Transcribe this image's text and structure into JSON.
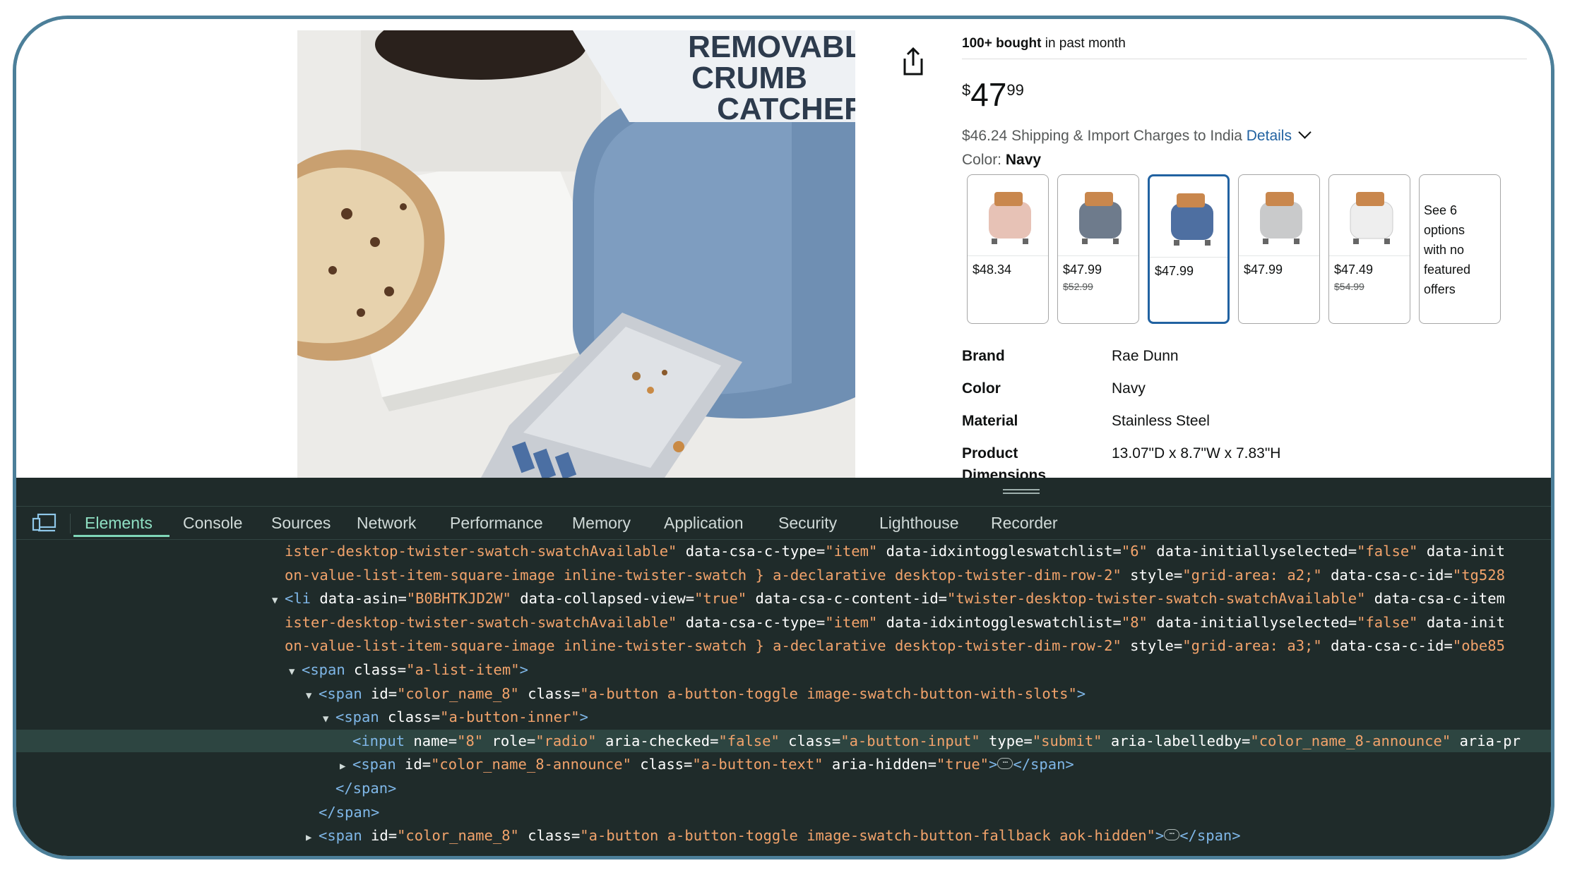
{
  "product": {
    "image_text": [
      "REMOVABLE",
      "CRUMB",
      "CATCHER"
    ],
    "bought_bold": "100+ bought",
    "bought_rest": " in past month",
    "price_symbol": "$",
    "price_whole": "47",
    "price_fraction": "99",
    "shipping_text": "$46.24 Shipping & Import Charges to India ",
    "shipping_details": "Details",
    "color_label": "Color: ",
    "color_value": "Navy",
    "swatches": [
      {
        "price": "$48.34",
        "old": "",
        "color": "#e7c2b6"
      },
      {
        "price": "$47.99",
        "old": "$52.99",
        "color": "#6e7b8c"
      },
      {
        "price": "$47.99",
        "old": "",
        "color": "#4e6fa1"
      },
      {
        "price": "$47.99",
        "old": "",
        "color": "#c9cacb"
      },
      {
        "price": "$47.49",
        "old": "$54.99",
        "color": "#eeeeee"
      }
    ],
    "more_options": [
      "See 6",
      "options",
      "with no",
      "featured",
      "offers"
    ],
    "specs": [
      {
        "key": "Brand",
        "value": "Rae Dunn"
      },
      {
        "key": "Color",
        "value": "Navy"
      },
      {
        "key": "Material",
        "value": "Stainless Steel"
      },
      {
        "key": "Product",
        "key2": "Dimensions",
        "value": "13.07\"D x 8.7\"W x 7.83\"H"
      }
    ]
  },
  "devtools": {
    "tabs": [
      "Elements",
      "Console",
      "Sources",
      "Network",
      "Performance",
      "Memory",
      "Application",
      "Security",
      "Lighthouse",
      "Recorder"
    ],
    "active_tab": "Elements",
    "colors": {
      "tag": "#7fb7e8",
      "attr": "#ffffff",
      "value": "#f2a36b",
      "active_tab": "#8fe0c3"
    },
    "lines": [
      {
        "indent": 0,
        "tri": "",
        "parts": [
          [
            "v",
            "ister-desktop-twister-swatch-swatchAvailable\""
          ],
          [
            "a",
            " data-csa-c-type="
          ],
          [
            "v",
            "\"item\""
          ],
          [
            "a",
            " data-idxintoggleswatchlist="
          ],
          [
            "v",
            "\"6\""
          ],
          [
            "a",
            " data-initiallyselected="
          ],
          [
            "v",
            "\"false\""
          ],
          [
            "a",
            " data-init"
          ]
        ]
      },
      {
        "indent": 0,
        "tri": "",
        "parts": [
          [
            "v",
            "on-value-list-item-square-image inline-twister-swatch } a-declarative desktop-twister-dim-row-2\""
          ],
          [
            "a",
            " style="
          ],
          [
            "v",
            "\"grid-area: a2;\""
          ],
          [
            "a",
            " data-csa-c-id="
          ],
          [
            "v",
            "\"tg528"
          ]
        ]
      },
      {
        "indent": 0,
        "tri": "▼",
        "parts": [
          [
            "t",
            "<li"
          ],
          [
            "a",
            " data-asin="
          ],
          [
            "v",
            "\"B0BHTKJD2W\""
          ],
          [
            "a",
            " data-collapsed-view="
          ],
          [
            "v",
            "\"true\""
          ],
          [
            "a",
            " data-csa-c-content-id="
          ],
          [
            "v",
            "\"twister-desktop-twister-swatch-swatchAvailable\""
          ],
          [
            "a",
            " data-csa-c-item"
          ]
        ]
      },
      {
        "indent": 0,
        "tri": "",
        "parts": [
          [
            "v",
            "ister-desktop-twister-swatch-swatchAvailable\""
          ],
          [
            "a",
            " data-csa-c-type="
          ],
          [
            "v",
            "\"item\""
          ],
          [
            "a",
            " data-idxintoggleswatchlist="
          ],
          [
            "v",
            "\"8\""
          ],
          [
            "a",
            " data-initiallyselected="
          ],
          [
            "v",
            "\"false\""
          ],
          [
            "a",
            " data-init"
          ]
        ]
      },
      {
        "indent": 0,
        "tri": "",
        "parts": [
          [
            "v",
            "on-value-list-item-square-image inline-twister-swatch } a-declarative desktop-twister-dim-row-2\""
          ],
          [
            "a",
            " style="
          ],
          [
            "v",
            "\"grid-area: a3;\""
          ],
          [
            "a",
            " data-csa-c-id="
          ],
          [
            "v",
            "\"obe85"
          ]
        ]
      },
      {
        "indent": 1,
        "tri": "▼",
        "parts": [
          [
            "t",
            "<span"
          ],
          [
            "a",
            " class="
          ],
          [
            "v",
            "\"a-list-item\""
          ],
          [
            "t",
            ">"
          ]
        ]
      },
      {
        "indent": 2,
        "tri": "▼",
        "parts": [
          [
            "t",
            "<span"
          ],
          [
            "a",
            " id="
          ],
          [
            "v",
            "\"color_name_8\""
          ],
          [
            "a",
            " class="
          ],
          [
            "v",
            "\"a-button a-button-toggle image-swatch-button-with-slots\""
          ],
          [
            "t",
            ">"
          ]
        ]
      },
      {
        "indent": 3,
        "tri": "▼",
        "parts": [
          [
            "t",
            "<span"
          ],
          [
            "a",
            " class="
          ],
          [
            "v",
            "\"a-button-inner\""
          ],
          [
            "t",
            ">"
          ]
        ]
      },
      {
        "indent": 4,
        "tri": "",
        "hl": true,
        "parts": [
          [
            "t",
            "<input"
          ],
          [
            "a",
            " name="
          ],
          [
            "v",
            "\"8\""
          ],
          [
            "a",
            " role="
          ],
          [
            "v",
            "\"radio\""
          ],
          [
            "a",
            " aria-checked="
          ],
          [
            "v",
            "\"false\""
          ],
          [
            "a",
            " class="
          ],
          [
            "v",
            "\"a-button-input\""
          ],
          [
            "a",
            " type="
          ],
          [
            "v",
            "\"submit\""
          ],
          [
            "a",
            " aria-labelledby="
          ],
          [
            "v",
            "\"color_name_8-announce\""
          ],
          [
            "a",
            " aria-pr"
          ]
        ]
      },
      {
        "indent": 4,
        "tri": "▶",
        "parts": [
          [
            "t",
            "<span"
          ],
          [
            "a",
            " id="
          ],
          [
            "v",
            "\"color_name_8-announce\""
          ],
          [
            "a",
            " class="
          ],
          [
            "v",
            "\"a-button-text\""
          ],
          [
            "a",
            " aria-hidden="
          ],
          [
            "v",
            "\"true\""
          ],
          [
            "t",
            ">"
          ],
          [
            "e",
            "⋯"
          ],
          [
            "t",
            "</span>"
          ]
        ]
      },
      {
        "indent": 3,
        "tri": "",
        "parts": [
          [
            "t",
            "</span>"
          ]
        ]
      },
      {
        "indent": 2,
        "tri": "",
        "parts": [
          [
            "t",
            "</span>"
          ]
        ]
      },
      {
        "indent": 2,
        "tri": "▶",
        "parts": [
          [
            "t",
            "<span"
          ],
          [
            "a",
            " id="
          ],
          [
            "v",
            "\"color_name_8\""
          ],
          [
            "a",
            " class="
          ],
          [
            "v",
            "\"a-button a-button-toggle image-swatch-button-fallback aok-hidden\""
          ],
          [
            "t",
            ">"
          ],
          [
            "e",
            "⋯"
          ],
          [
            "t",
            "</span>"
          ]
        ]
      }
    ]
  }
}
